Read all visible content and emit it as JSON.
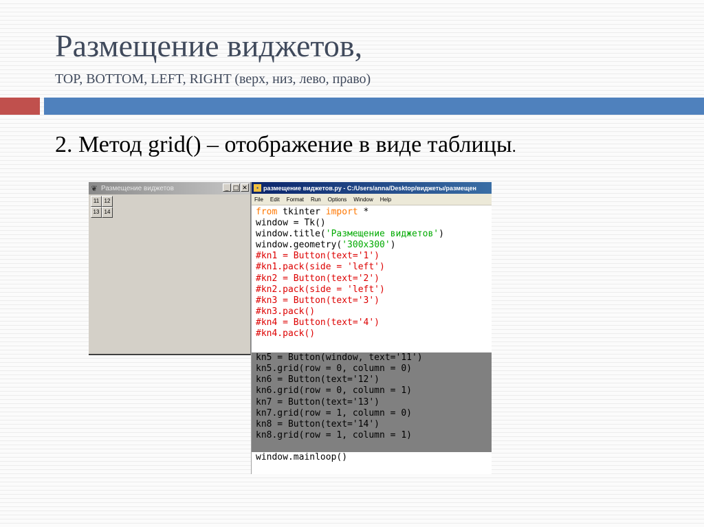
{
  "slide": {
    "title": "Размещение виджетов,",
    "subtitle": "TOP, BOTTOM, LEFT, RIGHT (верх, низ, лево, право)",
    "bullet": "2. Метод grid() – отображение в виде таблицы",
    "bullet_end": ".",
    "colors": {
      "title": "#404a5c",
      "accent_red": "#c0504d",
      "accent_blue": "#4f81bd"
    }
  },
  "tk_window": {
    "title": "Размещение виджетов",
    "icon": "feather-icon",
    "controls": {
      "minimize": "_",
      "maximize": "□",
      "close": "✕"
    },
    "buttons": [
      "11",
      "12",
      "13",
      "14"
    ]
  },
  "idle_window": {
    "title": "размещение виджетов.py - C:/Users/anna/Desktop/виджеты/размещен",
    "icon": "python-file-icon",
    "menu": [
      "File",
      "Edit",
      "Format",
      "Run",
      "Options",
      "Window",
      "Help"
    ],
    "code": {
      "l1": {
        "kw1": "from",
        "mid": " tkinter ",
        "kw2": "import",
        "rest": " *"
      },
      "l2": "window = Tk()",
      "l3": {
        "pre": "window.title(",
        "str": "'Размещение виджетов'",
        "post": ")"
      },
      "l4": {
        "pre": "window.geometry(",
        "str": "'300x300'",
        "post": ")"
      },
      "comments": [
        "#kn1 = Button(text='1')",
        "#kn1.pack(side = 'left')",
        "#kn2 = Button(text='2')",
        "#kn2.pack(side = 'left')",
        "#kn3 = Button(text='3')",
        "#kn3.pack()",
        "#kn4 = Button(text='4')",
        "#kn4.pack()"
      ],
      "block": [
        "kn5 = Button(window, text='11')",
        "kn5.grid(row = 0, column = 0)",
        "kn6 = Button(text='12')",
        "kn6.grid(row = 0, column = 1)",
        "kn7 = Button(text='13')",
        "kn7.grid(row = 1, column = 0)",
        "kn8 = Button(text='14')",
        "kn8.grid(row = 1, column = 1)"
      ],
      "last": "window.mainloop()"
    }
  }
}
